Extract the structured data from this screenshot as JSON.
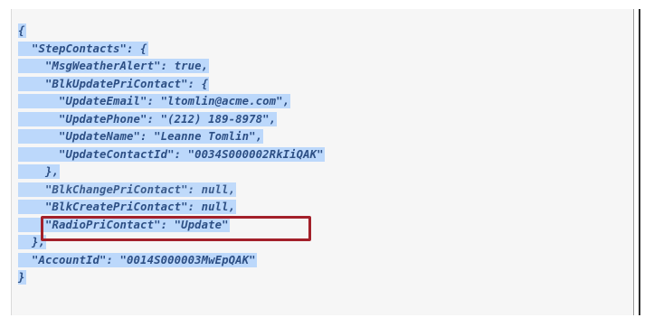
{
  "code": {
    "lines": [
      "{",
      "  \"StepContacts\": {",
      "    \"MsgWeatherAlert\": true,",
      "    \"BlkUpdatePriContact\": {",
      "      \"UpdateEmail\": \"ltomlin@acme.com\",",
      "      \"UpdatePhone\": \"(212) 189-8978\",",
      "      \"UpdateName\": \"Leanne Tomlin\",",
      "      \"UpdateContactId\": \"0034S000002RkIiQAK\"",
      "    },",
      "    \"BlkChangePriContact\": null,",
      "    \"BlkCreatePriContact\": null,",
      "    \"RadioPriContact\": \"Update\"",
      "  },",
      "  \"AccountId\": \"0014S000003MwEpQAK\"",
      "}"
    ]
  },
  "highlight": {
    "color": "#a3202a",
    "target_line": "\"BlkCreatePriContact\": null,"
  },
  "selection_color": "#bcd8fb",
  "text_color": "#2d4f84"
}
